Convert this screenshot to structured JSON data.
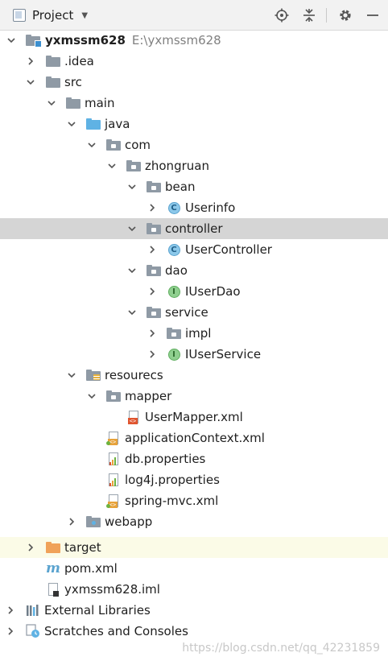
{
  "toolbar": {
    "title": "Project",
    "icons": [
      "locate-icon",
      "collapse-all-icon",
      "gear-icon",
      "minimize-icon"
    ]
  },
  "tree": [
    {
      "label": "yxmssm628",
      "path": "E:\\yxmssm628",
      "icon": "module-folder-icon",
      "expanded": true
    },
    {
      "label": ".idea",
      "icon": "folder-icon",
      "expanded": false
    },
    {
      "label": "src",
      "icon": "folder-icon",
      "expanded": true
    },
    {
      "label": "main",
      "icon": "folder-icon",
      "expanded": true
    },
    {
      "label": "java",
      "icon": "source-folder-icon",
      "expanded": true
    },
    {
      "label": "com",
      "icon": "package-icon",
      "expanded": true
    },
    {
      "label": "zhongruan",
      "icon": "package-icon",
      "expanded": true
    },
    {
      "label": "bean",
      "icon": "package-icon",
      "expanded": true
    },
    {
      "label": "Userinfo",
      "icon": "class-icon",
      "expanded": false
    },
    {
      "label": "controller",
      "icon": "package-icon",
      "expanded": true,
      "selected": true
    },
    {
      "label": "UserController",
      "icon": "class-icon",
      "expanded": false
    },
    {
      "label": "dao",
      "icon": "package-icon",
      "expanded": true
    },
    {
      "label": "IUserDao",
      "icon": "interface-icon",
      "expanded": false
    },
    {
      "label": "service",
      "icon": "package-icon",
      "expanded": true
    },
    {
      "label": "impl",
      "icon": "package-icon",
      "expanded": false
    },
    {
      "label": "IUserService",
      "icon": "interface-icon",
      "expanded": false
    },
    {
      "label": "resourecs",
      "icon": "resources-folder-icon",
      "expanded": true
    },
    {
      "label": "mapper",
      "icon": "package-icon",
      "expanded": true
    },
    {
      "label": "UserMapper.xml",
      "icon": "xml-file-icon"
    },
    {
      "label": "applicationContext.xml",
      "icon": "spring-xml-icon"
    },
    {
      "label": "db.properties",
      "icon": "properties-file-icon"
    },
    {
      "label": "log4j.properties",
      "icon": "properties-file-icon"
    },
    {
      "label": "spring-mvc.xml",
      "icon": "spring-xml-icon"
    },
    {
      "label": "webapp",
      "icon": "web-folder-icon",
      "expanded": false
    },
    {
      "label": "target",
      "icon": "excluded-folder-icon",
      "expanded": false,
      "highlighted": true
    },
    {
      "label": "pom.xml",
      "icon": "maven-icon"
    },
    {
      "label": "yxmssm628.iml",
      "icon": "iml-file-icon"
    },
    {
      "label": "External Libraries",
      "icon": "libraries-icon",
      "expanded": false
    },
    {
      "label": "Scratches and Consoles",
      "icon": "scratches-icon",
      "expanded": false
    }
  ],
  "watermark": "https://blog.csdn.net/qq_42231859",
  "colors": {
    "selection": "#d5d5d5",
    "highlight": "#fbfbe7",
    "folder": "#8f9aa5",
    "source": "#5fb2e4",
    "excluded": "#f0a259"
  }
}
